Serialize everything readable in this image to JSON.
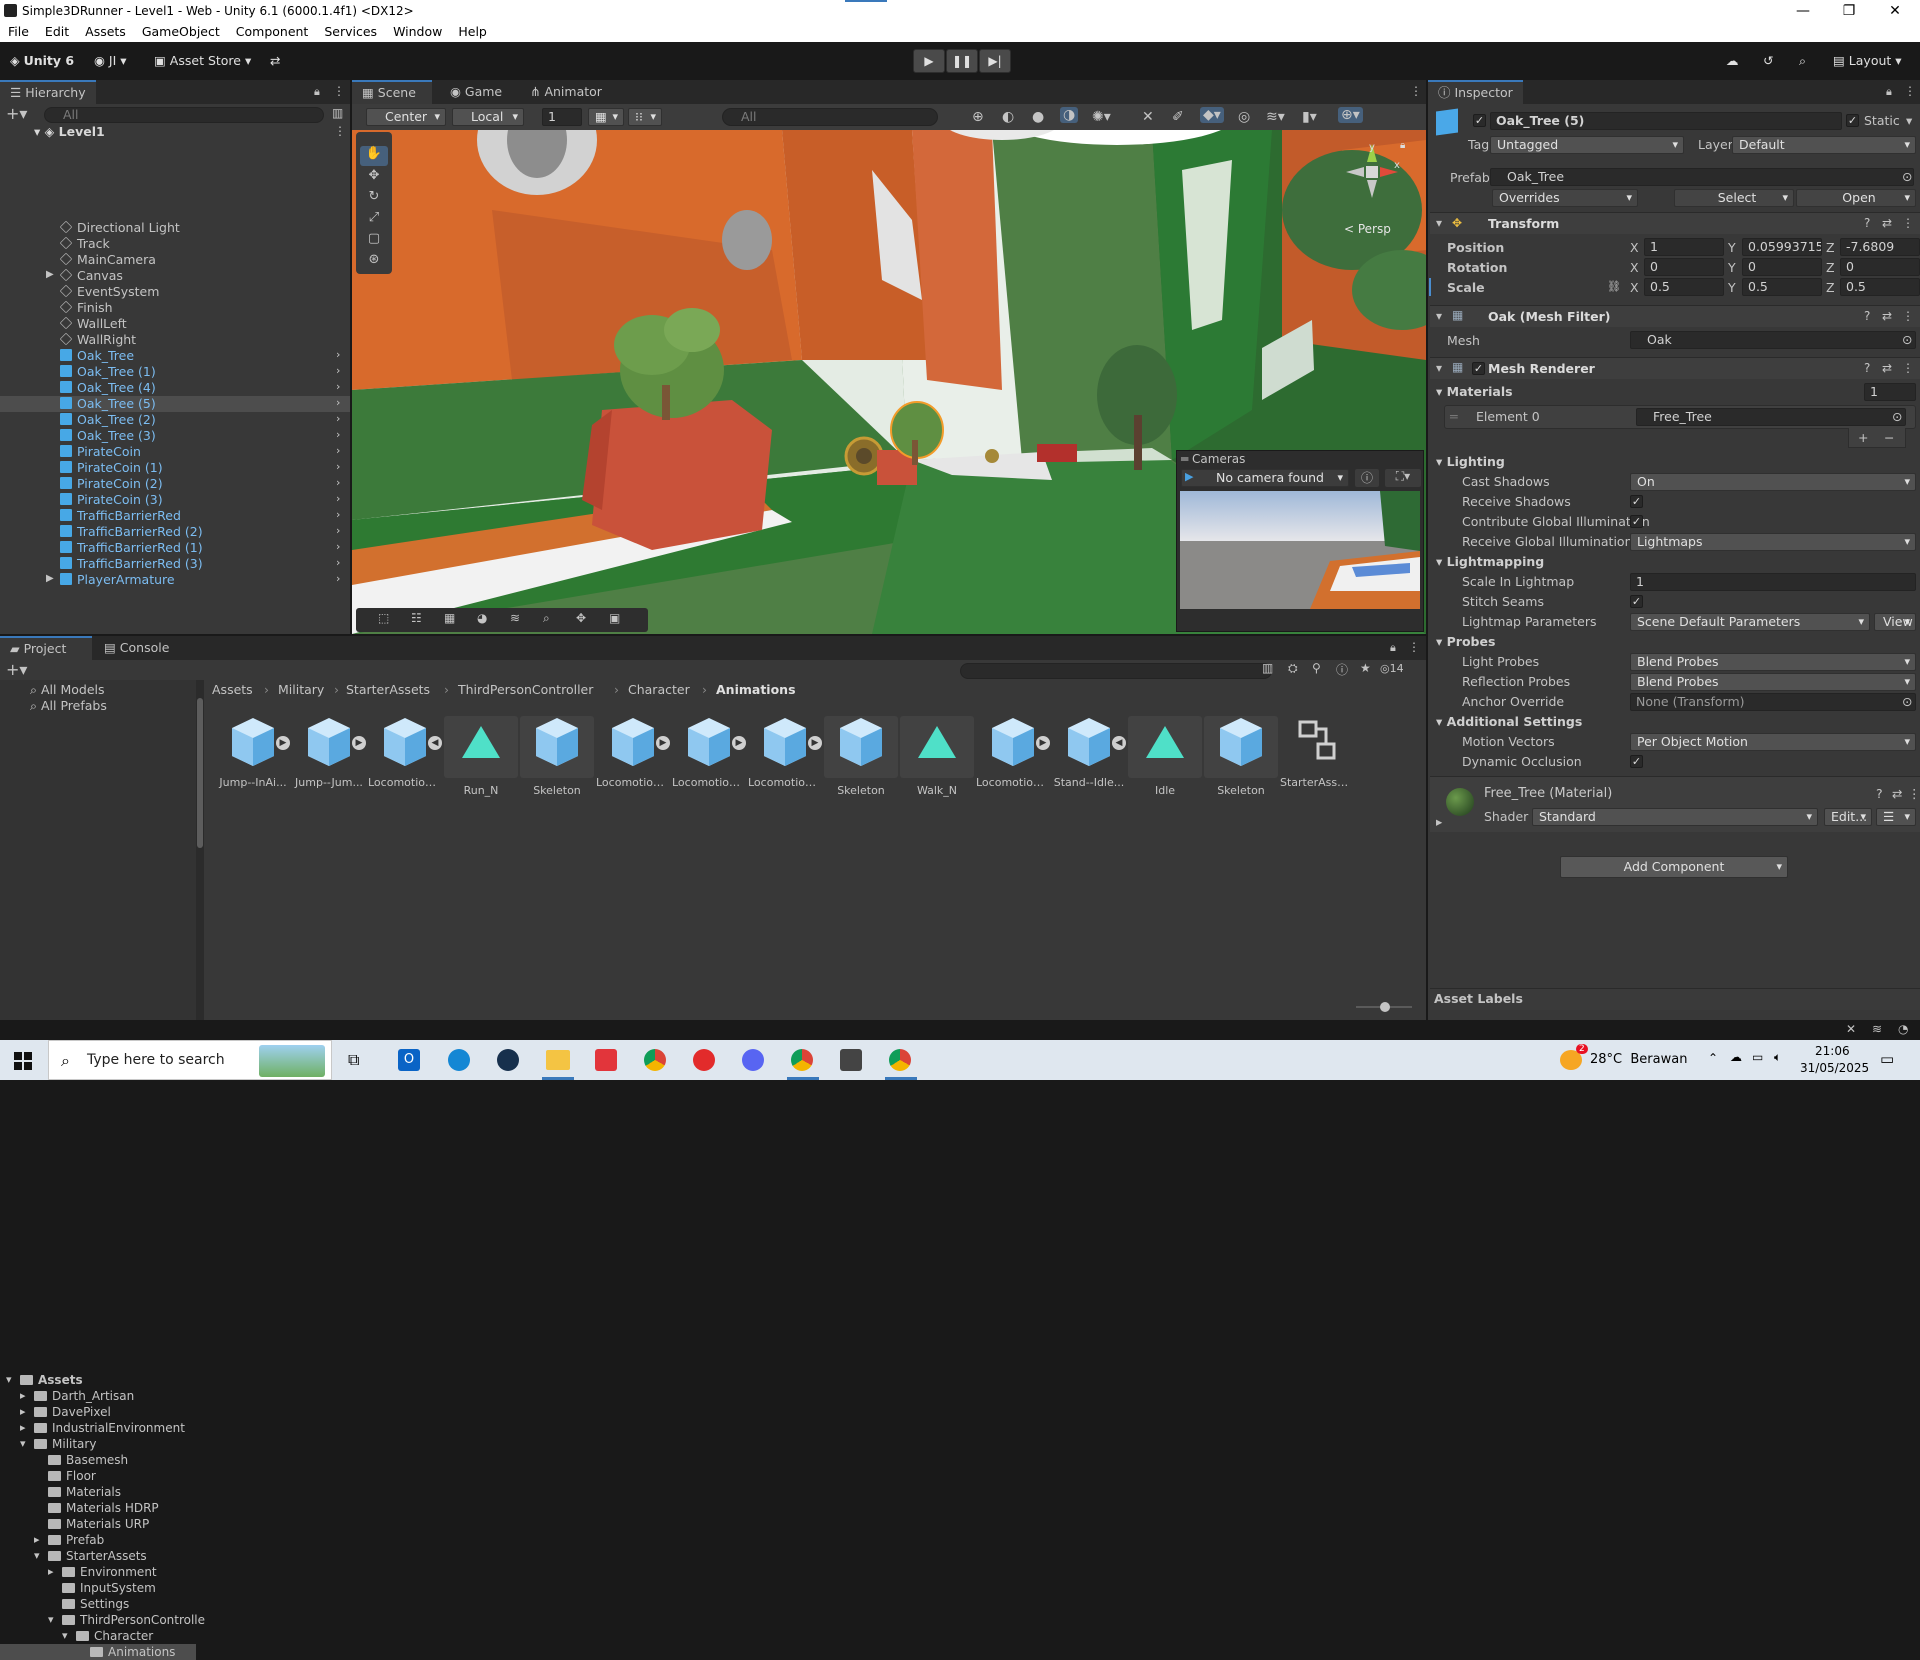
{
  "window": {
    "title": "Simple3DRunner - Level1 - Web - Unity 6.1 (6000.1.4f1) <DX12>"
  },
  "menu": [
    "File",
    "Edit",
    "Assets",
    "GameObject",
    "Component",
    "Services",
    "Window",
    "Help"
  ],
  "toolbar": {
    "unity_label": "Unity 6",
    "account_label": "JI",
    "asset_store_label": "Asset Store",
    "layout_label": "Layout"
  },
  "hierarchy": {
    "tab_label": "Hierarchy",
    "search_placeholder": "All",
    "scene_name": "Level1",
    "items": [
      {
        "name": "Directional Light",
        "type": "go"
      },
      {
        "name": "Track",
        "type": "go"
      },
      {
        "name": "MainCamera",
        "type": "go"
      },
      {
        "name": "Canvas",
        "type": "go",
        "expandable": true
      },
      {
        "name": "EventSystem",
        "type": "go"
      },
      {
        "name": "Finish",
        "type": "go"
      },
      {
        "name": "WallLeft",
        "type": "go"
      },
      {
        "name": "WallRight",
        "type": "go"
      },
      {
        "name": "Oak_Tree",
        "type": "prefab"
      },
      {
        "name": "Oak_Tree (1)",
        "type": "prefab"
      },
      {
        "name": "Oak_Tree (4)",
        "type": "prefab"
      },
      {
        "name": "Oak_Tree (5)",
        "type": "prefab",
        "selected": true
      },
      {
        "name": "Oak_Tree (2)",
        "type": "prefab"
      },
      {
        "name": "Oak_Tree (3)",
        "type": "prefab"
      },
      {
        "name": "PirateCoin",
        "type": "prefab"
      },
      {
        "name": "PirateCoin (1)",
        "type": "prefab"
      },
      {
        "name": "PirateCoin (2)",
        "type": "prefab"
      },
      {
        "name": "PirateCoin (3)",
        "type": "prefab"
      },
      {
        "name": "TrafficBarrierRed",
        "type": "prefab"
      },
      {
        "name": "TrafficBarrierRed (2)",
        "type": "prefab"
      },
      {
        "name": "TrafficBarrierRed (1)",
        "type": "prefab"
      },
      {
        "name": "TrafficBarrierRed (3)",
        "type": "prefab"
      },
      {
        "name": "PlayerArmature",
        "type": "prefab",
        "expandable": true
      }
    ]
  },
  "scene": {
    "tabs": [
      "Scene",
      "Game",
      "Animator"
    ],
    "pivot_label": "Center",
    "space_label": "Local",
    "grid_value": "1",
    "search_placeholder": "All",
    "persp_label": "< Persp",
    "cameras_overlay": {
      "title": "Cameras",
      "camera_label": "No camera found"
    }
  },
  "inspector": {
    "tab_label": "Inspector",
    "object_name": "Oak_Tree (5)",
    "static_label": "Static",
    "tag_label": "Tag",
    "tag_value": "Untagged",
    "layer_label": "Layer",
    "layer_value": "Default",
    "prefab_label": "Prefab",
    "prefab_value": "Oak_Tree",
    "overrides_label": "Overrides",
    "select_label": "Select",
    "open_label": "Open",
    "transform": {
      "title": "Transform",
      "position": {
        "label": "Position",
        "x": "1",
        "y": "0.05993715",
        "z": "-7.6809"
      },
      "rotation": {
        "label": "Rotation",
        "x": "0",
        "y": "0",
        "z": "0"
      },
      "scale": {
        "label": "Scale",
        "x": "0.5",
        "y": "0.5",
        "z": "0.5"
      }
    },
    "mesh_filter": {
      "title": "Oak (Mesh Filter)",
      "mesh_label": "Mesh",
      "mesh_value": "Oak"
    },
    "mesh_renderer": {
      "title": "Mesh Renderer",
      "materials_label": "Materials",
      "materials_count": "1",
      "element_label": "Element 0",
      "element_value": "Free_Tree",
      "lighting_label": "Lighting",
      "cast_shadows_label": "Cast Shadows",
      "cast_shadows_value": "On",
      "receive_shadows_label": "Receive Shadows",
      "contribute_gi_label": "Contribute Global Illumination",
      "receive_gi_label": "Receive Global Illumination",
      "receive_gi_value": "Lightmaps",
      "lightmapping_label": "Lightmapping",
      "scale_lightmap_label": "Scale In Lightmap",
      "scale_lightmap_value": "1",
      "stitch_seams_label": "Stitch Seams",
      "lightmap_params_label": "Lightmap Parameters",
      "lightmap_params_value": "Scene Default Parameters",
      "view_label": "View",
      "probes_label": "Probes",
      "light_probes_label": "Light Probes",
      "light_probes_value": "Blend Probes",
      "reflection_probes_label": "Reflection Probes",
      "reflection_probes_value": "Blend Probes",
      "anchor_override_label": "Anchor Override",
      "anchor_override_value": "None (Transform)",
      "additional_label": "Additional Settings",
      "motion_vectors_label": "Motion Vectors",
      "motion_vectors_value": "Per Object Motion",
      "dynamic_occlusion_label": "Dynamic Occlusion"
    },
    "material": {
      "title": "Free_Tree (Material)",
      "shader_label": "Shader",
      "shader_value": "Standard",
      "edit_label": "Edit..."
    },
    "add_component_label": "Add Component",
    "asset_labels": "Asset Labels"
  },
  "project": {
    "tabs": [
      "Project",
      "Console"
    ],
    "favorites": [
      "All Models",
      "All Prefabs"
    ],
    "tree": [
      {
        "name": "Assets",
        "depth": 0,
        "open": true,
        "bold": true
      },
      {
        "name": "Darth_Artisan",
        "depth": 1
      },
      {
        "name": "DavePixel",
        "depth": 1
      },
      {
        "name": "IndustrialEnvironment",
        "depth": 1
      },
      {
        "name": "Military",
        "depth": 1,
        "open": true
      },
      {
        "name": "Basemesh",
        "depth": 2
      },
      {
        "name": "Floor",
        "depth": 2
      },
      {
        "name": "Materials",
        "depth": 2
      },
      {
        "name": "Materials HDRP",
        "depth": 2
      },
      {
        "name": "Materials URP",
        "depth": 2
      },
      {
        "name": "Prefab",
        "depth": 2,
        "arrow": true
      },
      {
        "name": "StarterAssets",
        "depth": 2,
        "open": true
      },
      {
        "name": "Environment",
        "depth": 3,
        "arrow": true
      },
      {
        "name": "InputSystem",
        "depth": 3
      },
      {
        "name": "Settings",
        "depth": 3
      },
      {
        "name": "ThirdPersonControlle",
        "depth": 3,
        "open": true
      },
      {
        "name": "Character",
        "depth": 4,
        "open": true
      },
      {
        "name": "Animations",
        "depth": 5,
        "selected": true
      }
    ],
    "breadcrumb": [
      "Assets",
      "Military",
      "StarterAssets",
      "ThirdPersonController",
      "Character",
      "Animations"
    ],
    "hidden_count": "14",
    "assets": [
      {
        "name": "Jump--InAi...",
        "kind": "fbx"
      },
      {
        "name": "Jump--Jum...",
        "kind": "fbx"
      },
      {
        "name": "Locomotion...",
        "kind": "fbx",
        "left": true
      },
      {
        "name": "Run_N",
        "kind": "anim",
        "hl": true
      },
      {
        "name": "Skeleton",
        "kind": "avatar",
        "hl": true
      },
      {
        "name": "Locomotion...",
        "kind": "fbx"
      },
      {
        "name": "Locomotion...",
        "kind": "fbx"
      },
      {
        "name": "Locomotion...",
        "kind": "fbx"
      },
      {
        "name": "Skeleton",
        "kind": "avatar",
        "hl": true
      },
      {
        "name": "Walk_N",
        "kind": "anim",
        "hl": true
      },
      {
        "name": "Locomotion...",
        "kind": "fbx"
      },
      {
        "name": "Stand--Idle...",
        "kind": "fbx",
        "left": true
      },
      {
        "name": "Idle",
        "kind": "anim",
        "hl": true
      },
      {
        "name": "Skeleton",
        "kind": "avatar",
        "hl": true
      },
      {
        "name": "StarterAsse...",
        "kind": "controller"
      }
    ]
  },
  "taskbar": {
    "search_placeholder": "Type here to search",
    "weather": "28°C  Berawan",
    "time": "21:06",
    "date": "31/05/2025",
    "weather_badge": "2"
  }
}
